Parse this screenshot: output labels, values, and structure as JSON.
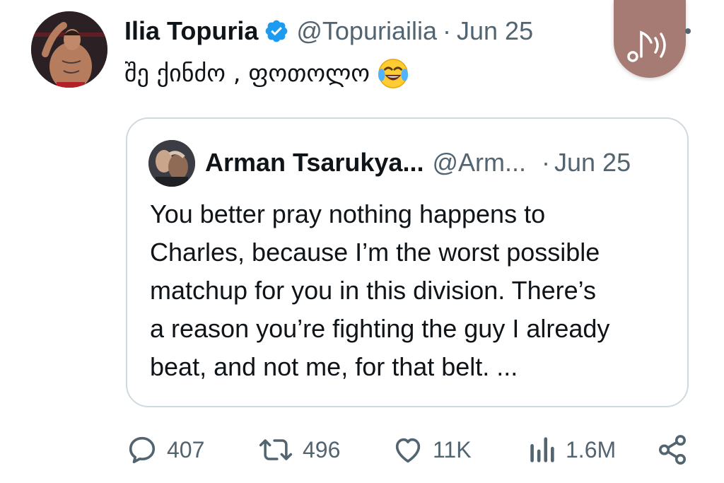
{
  "tweet": {
    "display_name": "Ilia Topuria",
    "handle": "@Topuriailia",
    "separator": "·",
    "date": "Jun 25",
    "text": "შე ქინძო , ფოთოლო",
    "emoji": "face-with-tears-of-joy",
    "verified": true,
    "verified_color": "#1d9bf0"
  },
  "quote": {
    "display_name": "Arman Tsarukya...",
    "handle": "@Arm...",
    "separator": "·",
    "date": "Jun 25",
    "body_lines": [
      "You better pray nothing happens to",
      "Charles, because I’m the worst possible",
      "matchup for you in this division. There’s",
      "a reason you’re fighting the guy I already",
      "beat, and not me, for that belt. ..."
    ]
  },
  "actions": {
    "replies": "407",
    "reposts": "496",
    "likes": "11K",
    "views": "1.6M",
    "icons": [
      "reply-icon",
      "repost-icon",
      "like-icon",
      "views-icon",
      "share-icon"
    ]
  },
  "overlay": {
    "audio_button_icon": "music-note-audio-icon",
    "audio_button_color": "#a57b73"
  },
  "colors": {
    "text_primary": "#0f1419",
    "text_secondary": "#536471",
    "border": "#cfd9de"
  }
}
